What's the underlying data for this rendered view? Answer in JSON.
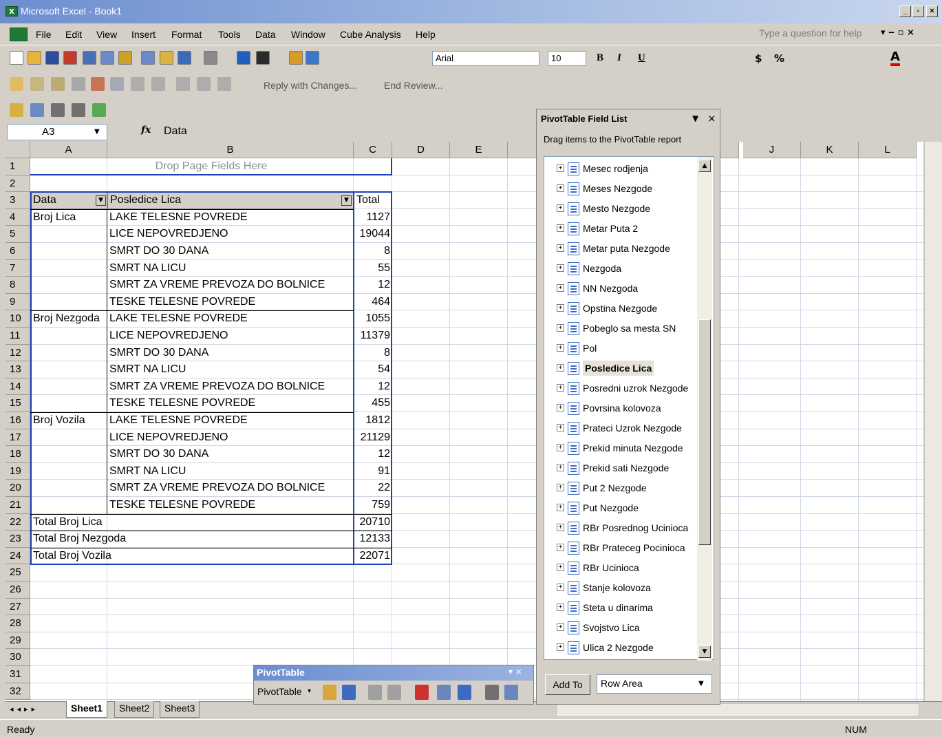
{
  "app": {
    "title": "Microsoft Excel - Book1"
  },
  "menu": [
    "File",
    "Edit",
    "View",
    "Insert",
    "Format",
    "Tools",
    "Data",
    "Window",
    "Cube Analysis",
    "Help"
  ],
  "help_placeholder": "Type a question for help",
  "toolbar": {
    "font": "Arial",
    "size": "10",
    "reply_label": "Reply with Changes...",
    "end_review_label": "End Review..."
  },
  "formula_bar": {
    "cell_ref": "A3",
    "fx": "fx",
    "content": "Data"
  },
  "columns": [
    "A",
    "B",
    "C",
    "D",
    "E",
    "",
    "",
    "",
    "",
    "J",
    "K",
    "L"
  ],
  "rows": [
    "1",
    "2",
    "3",
    "4",
    "5",
    "6",
    "7",
    "8",
    "9",
    "10",
    "11",
    "12",
    "13",
    "14",
    "15",
    "16",
    "17",
    "18",
    "19",
    "20",
    "21",
    "22",
    "23",
    "24",
    "25",
    "26",
    "27",
    "28",
    "29",
    "30",
    "31",
    "32"
  ],
  "pivot": {
    "drop_page": "Drop Page Fields Here",
    "header_data": "Data",
    "header_field": "Posledice Lica",
    "header_total": "Total",
    "groups": [
      {
        "name": "Broj Lica",
        "items": [
          {
            "label": "LAKE TELESNE POVREDE",
            "value": "1127"
          },
          {
            "label": "LICE NEPOVREDJENO",
            "value": "19044"
          },
          {
            "label": "SMRT DO 30 DANA",
            "value": "8"
          },
          {
            "label": "SMRT NA LICU",
            "value": "55"
          },
          {
            "label": "SMRT ZA VREME PREVOZA DO BOLNICE",
            "value": "12"
          },
          {
            "label": "TESKE TELESNE POVREDE",
            "value": "464"
          }
        ]
      },
      {
        "name": "Broj Nezgoda",
        "items": [
          {
            "label": "LAKE TELESNE POVREDE",
            "value": "1055"
          },
          {
            "label": "LICE NEPOVREDJENO",
            "value": "11379"
          },
          {
            "label": "SMRT DO 30 DANA",
            "value": "8"
          },
          {
            "label": "SMRT NA LICU",
            "value": "54"
          },
          {
            "label": "SMRT ZA VREME PREVOZA DO BOLNICE",
            "value": "12"
          },
          {
            "label": "TESKE TELESNE POVREDE",
            "value": "455"
          }
        ]
      },
      {
        "name": "Broj Vozila",
        "items": [
          {
            "label": "LAKE TELESNE POVREDE",
            "value": "1812"
          },
          {
            "label": "LICE NEPOVREDJENO",
            "value": "21129"
          },
          {
            "label": "SMRT DO 30 DANA",
            "value": "12"
          },
          {
            "label": "SMRT NA LICU",
            "value": "91"
          },
          {
            "label": "SMRT ZA VREME PREVOZA DO BOLNICE",
            "value": "22"
          },
          {
            "label": "TESKE TELESNE POVREDE",
            "value": "759"
          }
        ]
      }
    ],
    "totals": [
      {
        "label": "Total Broj Lica",
        "value": "20710"
      },
      {
        "label": "Total Broj Nezgoda",
        "value": "12133"
      },
      {
        "label": "Total Broj Vozila",
        "value": "22071"
      }
    ]
  },
  "field_list": {
    "title": "PivotTable Field List",
    "instruction": "Drag items to the PivotTable report",
    "fields": [
      "Mesec rodjenja",
      "Meses Nezgode",
      "Mesto Nezgode",
      "Metar Puta 2",
      "Metar puta Nezgode",
      "Nezgoda",
      "NN Nezgoda",
      "Opstina Nezgode",
      "Pobeglo sa mesta SN",
      "Pol",
      "Posledice Lica",
      "Posredni uzrok Nezgode",
      "Povrsina kolovoza",
      "Prateci Uzrok Nezgode",
      "Prekid minuta Nezgode",
      "Prekid sati Nezgode",
      "Put 2 Nezgode",
      "Put Nezgode",
      "RBr Posrednog Ucinioca",
      "RBr Prateceg Pocinioca",
      "RBr Ucinioca",
      "Stanje kolovoza",
      "Steta u dinarima",
      "Svojstvo Lica",
      "Ulica 2 Nezgode"
    ],
    "selected": "Posledice Lica",
    "add_to": "Add To",
    "area": "Row Area"
  },
  "pivot_toolbar": {
    "title": "PivotTable",
    "menu": "PivotTable"
  },
  "sheets": [
    "Sheet1",
    "Sheet2",
    "Sheet3"
  ],
  "status": {
    "ready": "Ready",
    "num": "NUM"
  },
  "colors": {
    "title_bar": "#6c8ecf",
    "excel_green": "#1f7a38",
    "pivot_border": "#1f3fbf",
    "grid_line": "#d0d7e5"
  }
}
